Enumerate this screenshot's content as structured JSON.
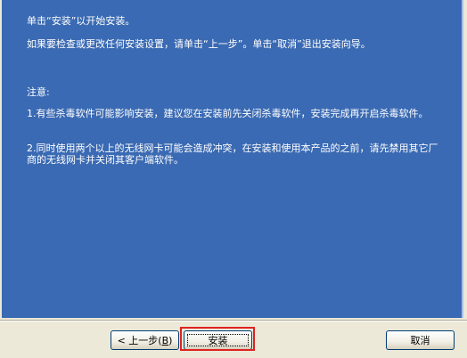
{
  "content": {
    "line1": "单击“安装”以开始安装。",
    "line2": "如果要检查或更改任何安装设置，请单击“上一步”。单击“取消”退出安装向导。",
    "notice_title": "注意:",
    "notice1": "1.有些杀毒软件可能影响安装，建议您在安装前先关闭杀毒软件，安装完成再开启杀毒软件。",
    "notice2": "2.同时使用两个以上的无线网卡可能会造成冲突，在安装和使用本产品的之前，请先禁用其它厂商的无线网卡并关闭其客户端软件。"
  },
  "buttons": {
    "back_label": "< 上一步(",
    "back_hotkey": "B",
    "back_suffix": ")",
    "install_label": "安装",
    "cancel_label": "取消"
  },
  "colors": {
    "panel_background": "#3a6ab3",
    "highlight_border": "#e0221f"
  }
}
